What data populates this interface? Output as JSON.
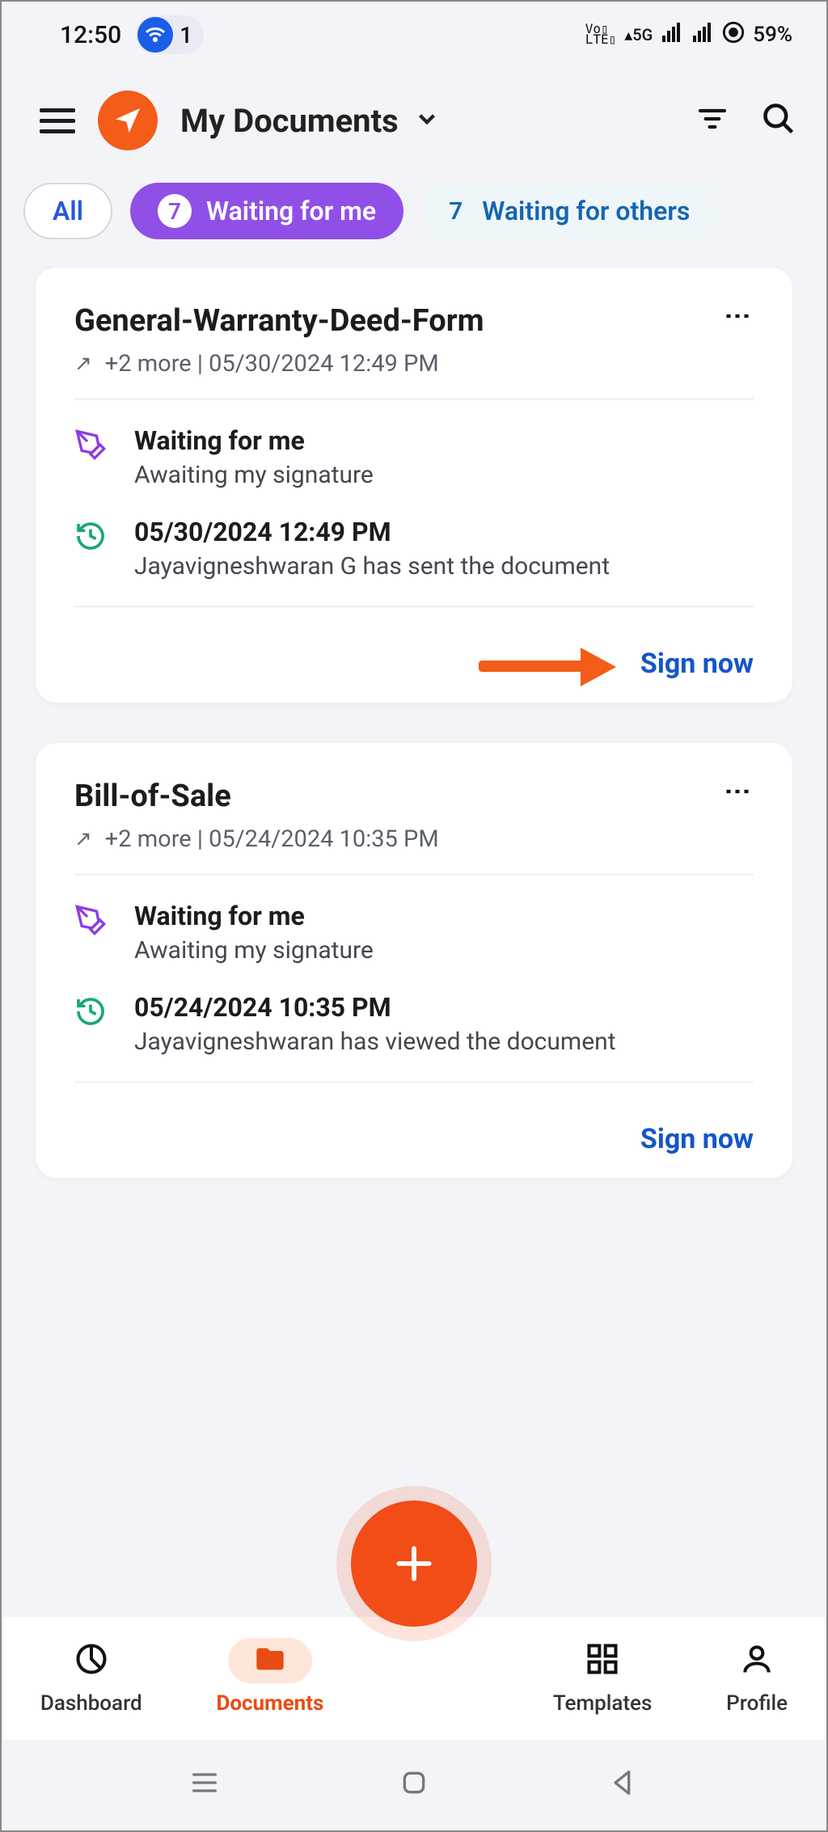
{
  "status": {
    "time": "12:50",
    "wifi_count": "1",
    "network": "5G",
    "volte": "VoLTE",
    "battery": "59%"
  },
  "header": {
    "title": "My Documents"
  },
  "chips": {
    "all": "All",
    "active": {
      "count": "7",
      "label": "Waiting for me"
    },
    "others": {
      "count": "7",
      "label": "Waiting for others"
    }
  },
  "cards": [
    {
      "title": "General-Warranty-Deed-Form",
      "meta": "+2 more | 05/30/2024 12:49 PM",
      "status_title": "Waiting for me",
      "status_sub": "Awaiting my signature",
      "activity_time": "05/30/2024 12:49 PM",
      "activity_text": "Jayavigneshwaran G has sent the document",
      "action": "Sign now",
      "show_arrow": true
    },
    {
      "title": "Bill-of-Sale",
      "meta": "+2 more | 05/24/2024 10:35 PM",
      "status_title": "Waiting for me",
      "status_sub": "Awaiting my signature",
      "activity_time": "05/24/2024 10:35 PM",
      "activity_text": "Jayavigneshwaran has viewed the document",
      "action": "Sign now",
      "show_arrow": false
    }
  ],
  "nav": {
    "dashboard": "Dashboard",
    "documents": "Documents",
    "templates": "Templates",
    "profile": "Profile"
  }
}
